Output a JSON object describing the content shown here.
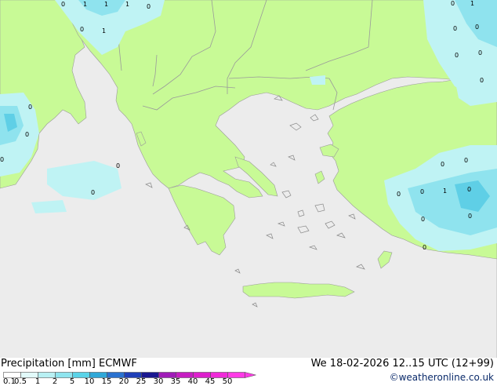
{
  "footer": {
    "title": "Precipitation [mm]  ECMWF",
    "valid_time": "We 18-02-2026 12..15 UTC (12+99)",
    "credit": "©weatheronline.co.uk"
  },
  "legend": {
    "labels": [
      "0.1",
      "0.5",
      "1",
      "2",
      "5",
      "10",
      "15",
      "20",
      "25",
      "30",
      "35",
      "40",
      "45",
      "50"
    ],
    "colors": [
      "#ffffff",
      "#e2fbfb",
      "#b8f0f3",
      "#8ee4ee",
      "#5ad3e8",
      "#2fa8d8",
      "#2a72d0",
      "#1f3fb8",
      "#1a1890",
      "#a01bb8",
      "#c61dc2",
      "#dd1fcd",
      "#f02ad9",
      "#ff3ae6"
    ]
  },
  "map": {
    "colors": {
      "sea": "#ececec",
      "land": "#c8fa96",
      "border": "#9a9a9a",
      "precip_light": "#bff3f4",
      "precip_mid": "#8fe3ee",
      "precip_heavy": "#5fcfe6"
    },
    "precip_markers": [
      "0",
      "1",
      "1",
      "1",
      "1",
      "0",
      "0",
      "0",
      "0",
      "0",
      "1",
      "0",
      "0",
      "0",
      "0",
      "0",
      "0",
      "0",
      "0",
      "1",
      "0",
      "0",
      "0",
      "0",
      "0",
      "0",
      "0",
      "0"
    ]
  }
}
